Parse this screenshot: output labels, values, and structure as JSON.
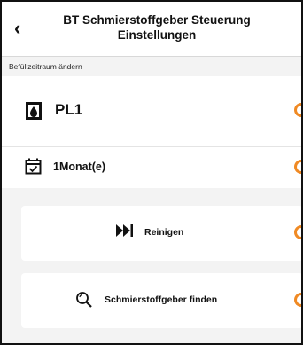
{
  "header": {
    "back_icon": "chevron-left-icon",
    "title": "BT Schmierstoffgeber Steuerung Einstellungen"
  },
  "section": {
    "label": "Befüllzeitraum ändern"
  },
  "rows": [
    {
      "icon": "cartridge-icon",
      "text": "PL1"
    },
    {
      "icon": "calendar-check-icon",
      "text": "1Monat(e)"
    }
  ],
  "actions": {
    "clean_icon": "skip-forward-icon",
    "clean_label": "Reinigen",
    "find_icon": "search-icon",
    "find_label": "Schmierstoffgeber finden"
  },
  "colors": {
    "accent": "#f08a24",
    "background": "#f3f3f3"
  }
}
